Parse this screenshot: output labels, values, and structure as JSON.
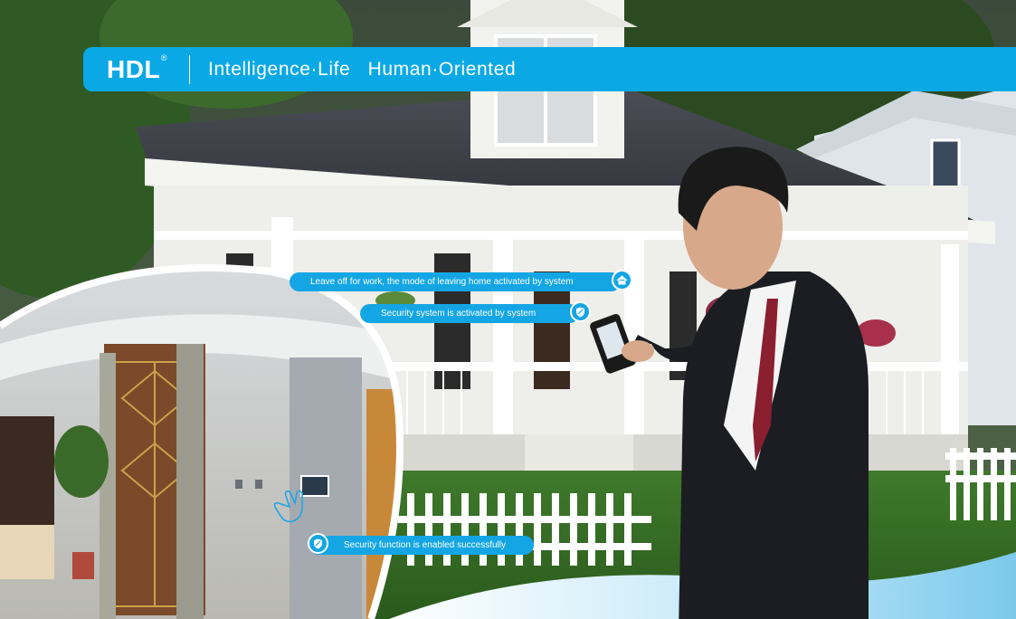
{
  "header": {
    "brand": "HDL",
    "registered": "®",
    "tagline": "Intelligence·Life   Human·Oriented"
  },
  "notifications": [
    {
      "text": "Leave off for work, the mode of leaving home activated by system",
      "icon": "house-icon"
    },
    {
      "text": "Security system is activated by system",
      "icon": "shield-icon"
    },
    {
      "text": "Security function is enabled successfully",
      "icon": "shield-icon"
    }
  ],
  "colors": {
    "accent": "#0aa9e6",
    "pill": "#14a6e4"
  }
}
